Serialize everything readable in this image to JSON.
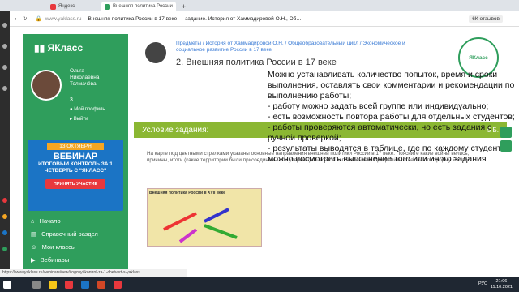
{
  "browser": {
    "tabs": [
      {
        "label": "Яндекс",
        "color": "#e8383d"
      },
      {
        "label": "Внешняя политика России",
        "color": "#2f9e5c"
      }
    ],
    "url_domain": "www.yaklass.ru",
    "url_title": "Внешняя политика России в 17 веке — задание. История от Хаммадировой О.Н., Об…",
    "reviews_label": "6К отзывов",
    "status_url": "https://www.yaklass.ru/webinars/new/itogovyi-kontrol-za-1-chetvert-s-yaklass"
  },
  "sidebar": {
    "logo": "ЯКласс",
    "user_first": "Ольга",
    "user_middle": "Николаевна",
    "user_last": "Толмачёва",
    "level": "3",
    "profile_link": "Мой профиль",
    "logout_link": "Выйти",
    "promo": {
      "date": "13 ОКТЯБРЯ",
      "title": "ВЕБИНАР",
      "subtitle": "ИТОГОВЫЙ КОНТРОЛЬ ЗА 1 ЧЕТВЕРТЬ С \"ЯКЛАСС\"",
      "button": "ПРИНЯТЬ УЧАСТИЕ"
    },
    "nav": [
      {
        "label": "Начало"
      },
      {
        "label": "Справочный раздел"
      },
      {
        "label": "Мои классы"
      },
      {
        "label": "Вебинары"
      }
    ]
  },
  "page": {
    "breadcrumbs": "Предметы / История от Хаммадировой О.Н. / Общеобразовательный цикл / Экономическое и социальное развитие России в 17 веке",
    "title": "2. Внешняя политика России в 17 веке",
    "badge": "ЯКласс",
    "task_label": "Условие задания:",
    "points": "5 Б.",
    "task_text": "На карте под цветными стрелками указаны основные направления внешней политики России в 17 веке. Поясните какие войны велись, причины, итоги (какие территории были присоединены или утеряны) по всем 4 направлениям. Прикрепить ответ на платформу ЯКласс.",
    "map_title": "Внешняя политика России в XVII веке"
  },
  "overlay_text": "Можно устанавливать количество попыток, время и сроки выполнения, оставлять свои комментарии и рекомендации по выполнению работы;\n- работу можно задать всей группе или индивидуально;\n- есть возможность повтора работы для отдельных студентов;\n- работы проверяются автоматически, но есть задания с ручной проверкой;\n- результаты выводятся в таблице, где по каждому студенту можно посмотреть выполнение того или иного задания",
  "taskbar": {
    "lang": "РУС",
    "time": "21:06",
    "date": "11.10.2021"
  }
}
